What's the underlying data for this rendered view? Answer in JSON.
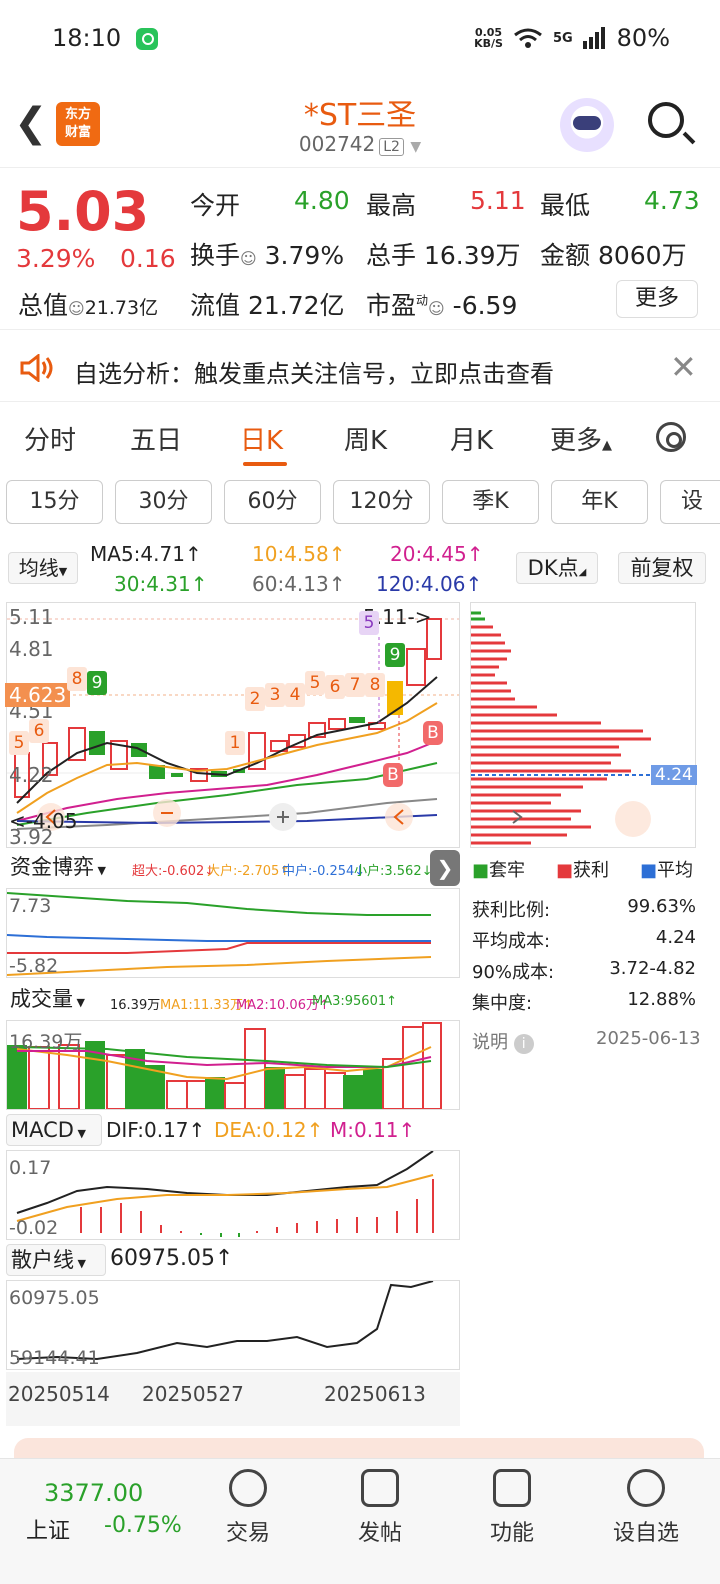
{
  "status": {
    "time": "18:10",
    "speed_top": "0.05",
    "speed_bottom": "KB/S",
    "network": "5G",
    "battery": "80%"
  },
  "header": {
    "logo_line1": "东方",
    "logo_line2": "财富",
    "title": "*ST三圣",
    "code": "002742",
    "level": "L2"
  },
  "quote": {
    "price": "5.03",
    "change_pct": "3.29%",
    "change": "0.16",
    "open_label": "今开",
    "open": "4.80",
    "high_label": "最高",
    "high": "5.11",
    "low_label": "最低",
    "low": "4.73",
    "turnover_label": "换手",
    "turnover": "3.79%",
    "volume_label": "总手",
    "volume": "16.39万",
    "amount_label": "金额",
    "amount": "8060万",
    "mktcap_label": "总值",
    "mktcap": "21.73亿",
    "float_label": "流值",
    "float": "21.72亿",
    "pe_label": "市盈",
    "pe_sup": "动",
    "pe": "-6.59",
    "more": "更多"
  },
  "notice": {
    "text": "自选分析：触发重点关注信号，立即点击查看"
  },
  "tabs": [
    "分时",
    "五日",
    "日K",
    "周K",
    "月K",
    "更多"
  ],
  "periods": [
    "15分",
    "30分",
    "60分",
    "120分",
    "季K",
    "年K",
    "设置"
  ],
  "ma": {
    "label": "均线",
    "ma5": "MA5:4.71",
    "ma10": "10:4.58",
    "ma20": "20:4.45",
    "ma30": "30:4.31",
    "ma60": "60:4.13",
    "ma120": "120:4.06",
    "dk": "DK点",
    "fq": "前复权"
  },
  "kline": {
    "y_top": "5.11",
    "y2": "4.81",
    "y3": "4.51",
    "y4": "4.22",
    "y_bot": "3.92",
    "cur": "4.623",
    "high_mark": "5.11->",
    "low_mark": "<-4.05",
    "watermark": "东方财富"
  },
  "chip": {
    "avg_tag": "4.24",
    "legend": [
      "套牢",
      "获利",
      "平均"
    ],
    "rows": [
      [
        "获利比例:",
        "99.63%"
      ],
      [
        "平均成本:",
        "4.24"
      ],
      [
        "90%成本:",
        "3.72-4.82"
      ],
      [
        "集中度:",
        "12.88%"
      ]
    ],
    "note": "说明",
    "date": "2025-06-13"
  },
  "fund": {
    "label": "资金博弈",
    "super": "超大:-0.602",
    "big": "大户:-2.705",
    "mid": "中户:-0.254",
    "small": "小户:3.562",
    "y_top": "7.73",
    "y_bot": "-5.82"
  },
  "vol": {
    "label": "成交量",
    "v": "16.39万",
    "ma1": "MA1:11.33万",
    "ma2": "MA2:10.06万",
    "ma3": "MA3:95601",
    "y_top": "16.39万"
  },
  "macd": {
    "label": "MACD",
    "dif": "DIF:0.17",
    "dea": "DEA:0.12",
    "m": "M:0.11",
    "y_top": "0.17",
    "y_bot": "-0.02"
  },
  "retail": {
    "label": "散户线",
    "value": "60975.05",
    "y_top": "60975.05",
    "y_bot": "59144.41"
  },
  "dates": [
    "20250514",
    "20250527",
    "20250613"
  ],
  "bottom": {
    "index_val": "3377.00",
    "index_name": "上证",
    "index_chg": "-0.75%",
    "nav": [
      "交易",
      "发帖",
      "功能",
      "设自选"
    ]
  },
  "colors": {
    "up": "#e4393c",
    "down": "#2aa12a",
    "accent": "#e85b10"
  }
}
